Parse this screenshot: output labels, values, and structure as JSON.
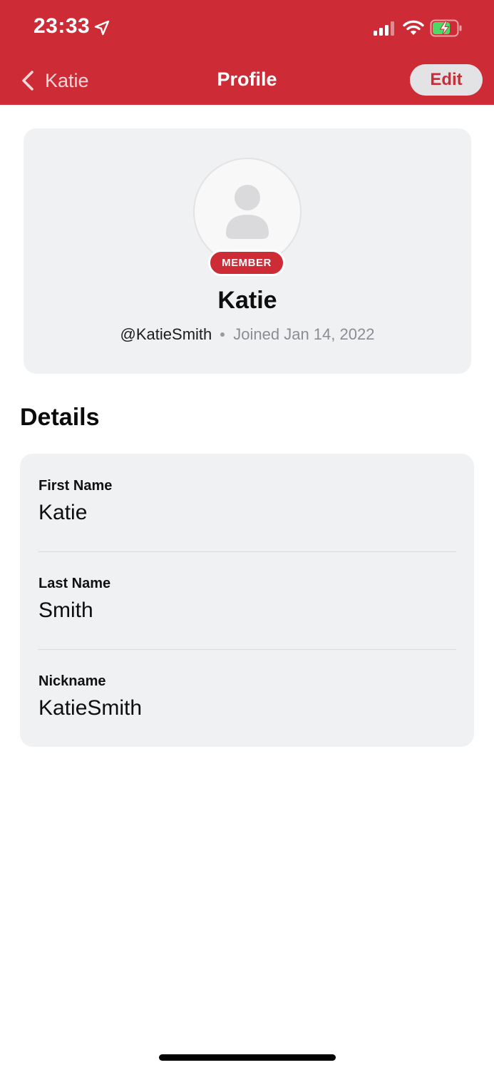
{
  "status_bar": {
    "time": "23:33",
    "icons": [
      "location-arrow-icon",
      "cellular-signal-icon",
      "wifi-icon",
      "battery-charging-icon"
    ]
  },
  "nav": {
    "back_label": "Katie",
    "title": "Profile",
    "edit_label": "Edit"
  },
  "profile": {
    "badge": "MEMBER",
    "name": "Katie",
    "handle": "@KatieSmith",
    "joined": "Joined Jan 14, 2022"
  },
  "details": {
    "heading": "Details",
    "rows": [
      {
        "label": "First Name",
        "value": "Katie"
      },
      {
        "label": "Last Name",
        "value": "Smith"
      },
      {
        "label": "Nickname",
        "value": "KatieSmith"
      }
    ]
  },
  "colors": {
    "brand_red": "#cd2b36",
    "card_background": "#f0f1f3",
    "muted_text": "#8c8d93",
    "battery_green": "#4cd964"
  }
}
